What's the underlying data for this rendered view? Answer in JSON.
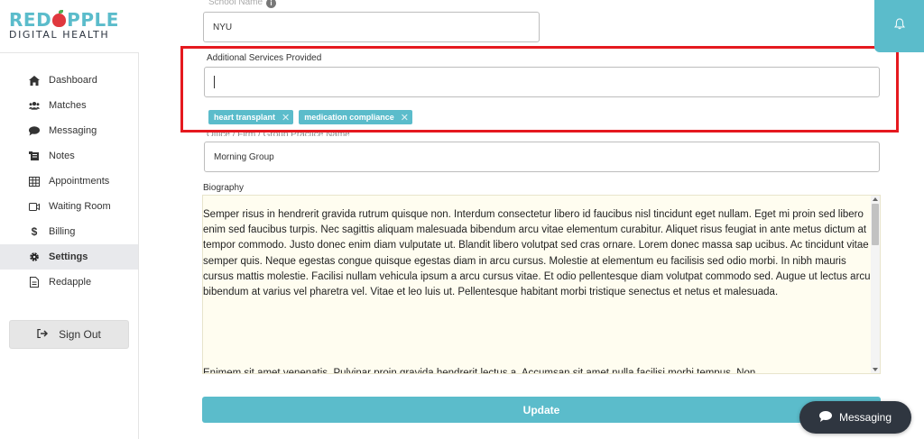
{
  "logo": {
    "top_pre": "RED",
    "top_post": "PPLE",
    "sub": "DIGITAL HEALTH"
  },
  "sidebar": {
    "items": [
      {
        "label": "Dashboard",
        "icon": "home-icon"
      },
      {
        "label": "Matches",
        "icon": "users-icon"
      },
      {
        "label": "Messaging",
        "icon": "chat-icon"
      },
      {
        "label": "Notes",
        "icon": "notes-icon"
      },
      {
        "label": "Appointments",
        "icon": "calendar-grid-icon"
      },
      {
        "label": "Waiting Room",
        "icon": "video-icon"
      },
      {
        "label": "Billing",
        "icon": "dollar-icon"
      },
      {
        "label": "Settings",
        "icon": "gear-icon",
        "active": true
      },
      {
        "label": "Redapple",
        "icon": "document-icon"
      }
    ],
    "sign_out": "Sign Out"
  },
  "form": {
    "school_label": "School Name",
    "school_value": "NYU",
    "services_label": "Additional Services Provided",
    "services_value": "",
    "tags": [
      "heart transplant",
      "medication compliance"
    ],
    "office_label": "Office / Firm / Group Practice Name",
    "office_value": "Morning Group",
    "bio_label": "Biography",
    "bio_paragraph_1": "Semper risus in hendrerit gravida rutrum quisque non. Interdum consectetur libero id faucibus nisl tincidunt eget nullam. Eget mi proin sed libero enim sed faucibus turpis. Nec sagittis aliquam malesuada bibendum arcu vitae elementum curabitur. Aliquet risus feugiat in ante metus dictum at tempor commodo. Justo donec enim diam vulputate ut. Blandit libero volutpat sed cras ornare. Lorem donec massa sap ucibus. Ac tincidunt vitae semper quis. Neque egestas congue quisque egestas diam in arcu cursus. Molestie at elementum eu facilisis sed odio morbi. In nibh mauris cursus mattis molestie. Facilisi nullam vehicula ipsum a arcu cursus vitae. Et odio pellentesque diam volutpat commodo sed. Augue ut lectus arcu bibendum at varius vel pharetra vel. Vitae et leo luis ut. Pellentesque habitant morbi tristique senectus et netus et malesuada.",
    "bio_paragraph_2": "Enimem sit amet venenatis. Pulvinar proin gravida hendrerit lectus a. Accumsan sit amet nulla facilisi morbi tempus. Non",
    "update_label": "Update"
  },
  "widgets": {
    "messaging_label": "Messaging"
  },
  "colors": {
    "accent": "#5bbccb",
    "highlight": "#e5191f",
    "dark": "#2f3640"
  }
}
